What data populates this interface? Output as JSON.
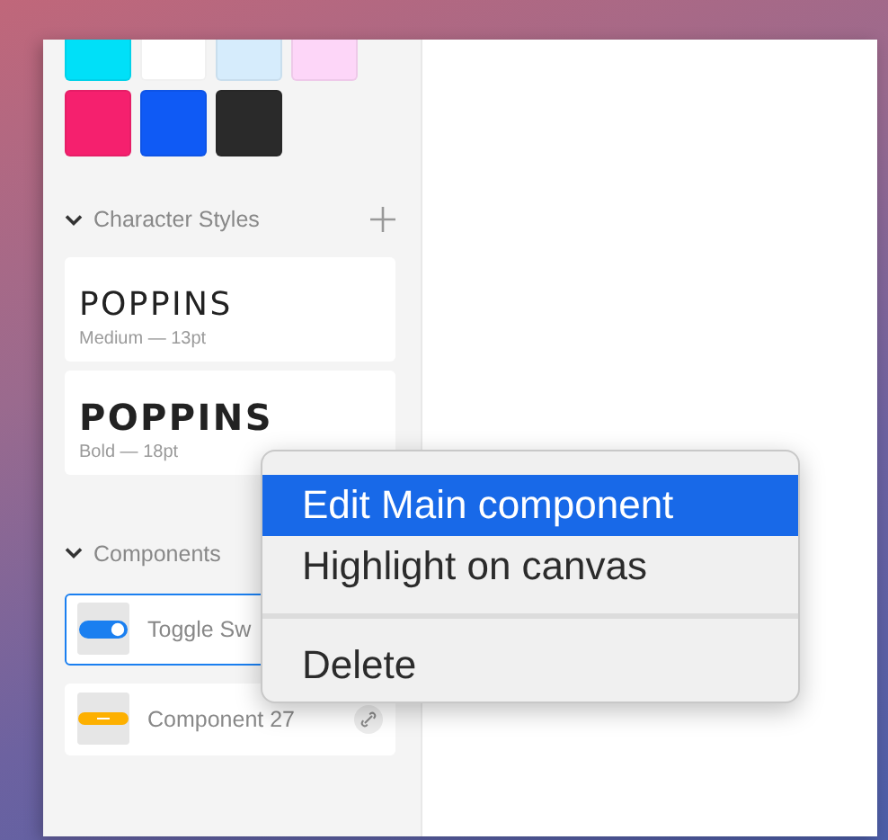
{
  "swatches": [
    {
      "color": "#00e0f8"
    },
    {
      "color": "#ffffff"
    },
    {
      "color": "#d6ecfc"
    },
    {
      "color": "#fdd6f8"
    },
    {
      "color": "#f5206e"
    },
    {
      "color": "#0f5af5"
    },
    {
      "color": "#2a2a2a"
    }
  ],
  "character_styles": {
    "title": "Character Styles",
    "expanded": true,
    "styles": [
      {
        "sample": "POPPINS",
        "detail": "Medium — 13pt",
        "kind": "medium"
      },
      {
        "sample": "POPPINS",
        "detail": "Bold — 18pt",
        "kind": "bold"
      }
    ]
  },
  "components": {
    "title": "Components",
    "expanded": true,
    "items": [
      {
        "name": "Toggle Sw",
        "kind": "toggle",
        "selected": true
      },
      {
        "name": "Component 27",
        "kind": "button",
        "selected": false,
        "linked": true
      }
    ]
  },
  "context_menu": {
    "groups": [
      [
        {
          "label": "Edit Main component",
          "selected": true
        },
        {
          "label": "Highlight on canvas",
          "selected": false
        }
      ],
      [
        {
          "label": "Delete",
          "selected": false
        }
      ]
    ]
  }
}
